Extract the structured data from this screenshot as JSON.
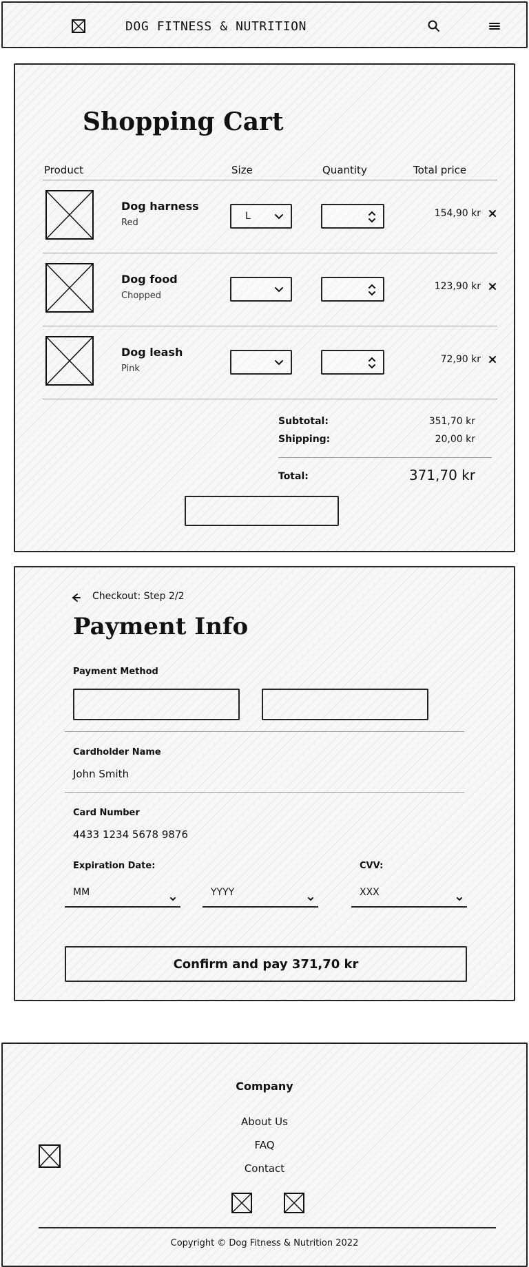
{
  "header": {
    "brand": "DOG FITNESS & NUTRITION",
    "icons": {
      "logo": "image-placeholder-icon",
      "search": "search-icon",
      "menu": "hamburger-menu-icon"
    }
  },
  "cart": {
    "title": "Shopping Cart",
    "columns": {
      "product": "Product",
      "size": "Size",
      "quantity": "Quantity",
      "total_price": "Total price"
    },
    "items": [
      {
        "name": "Dog harness",
        "variant": "Red",
        "size": "L",
        "quantity": "",
        "price": "154,90 kr"
      },
      {
        "name": "Dog food",
        "variant": "Chopped",
        "size": "",
        "quantity": "",
        "price": "123,90 kr"
      },
      {
        "name": "Dog leash",
        "variant": "Pink",
        "size": "",
        "quantity": "",
        "price": "72,90 kr"
      }
    ],
    "summary": {
      "subtotal_label": "Subtotal:",
      "subtotal_value": "351,70 kr",
      "shipping_label": "Shipping:",
      "shipping_value": "20,00 kr",
      "total_label": "Total:",
      "total_value": "371,70 kr"
    }
  },
  "payment": {
    "step_text": "Checkout: Step 2/2",
    "title": "Payment Info",
    "payment_method_label": "Payment Method",
    "cardholder_label": "Cardholder Name",
    "cardholder_value": "John Smith",
    "card_number_label": "Card Number",
    "card_number_value": "4433 1234 5678 9876",
    "expiration_label": "Expiration Date:",
    "mm_placeholder": "MM",
    "yyyy_placeholder": "YYYY",
    "cvv_label": "CVV:",
    "cvv_placeholder": "XXX",
    "confirm_label": "Confirm and pay 371,70 kr"
  },
  "footer": {
    "company_title": "Company",
    "links": [
      "About Us",
      "FAQ",
      "Contact"
    ],
    "copyright": "Copyright © Dog Fitness & Nutrition 2022"
  }
}
